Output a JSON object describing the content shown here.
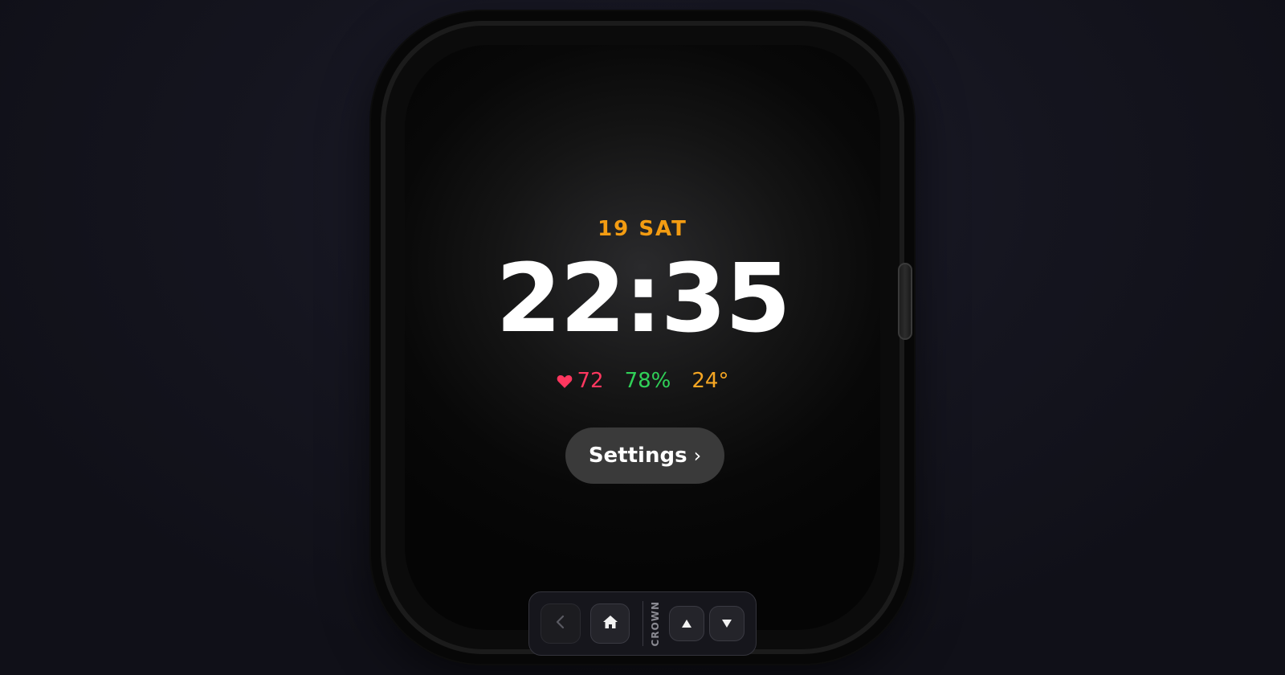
{
  "watch": {
    "date": "19 SAT",
    "time": "22:35",
    "complications": {
      "heart_rate": "72",
      "battery": "78%",
      "temperature": "24°"
    },
    "settings_button": {
      "label": "Settings",
      "chevron": "›"
    }
  },
  "controls": {
    "crown_label": "CROWN",
    "back_icon": "chevron-left-icon",
    "home_icon": "home-icon",
    "up_icon": "triangle-up-icon",
    "down_icon": "triangle-down-icon"
  },
  "colors": {
    "date": "#f39c12",
    "heart": "#ff375f",
    "battery": "#30d158",
    "temperature": "#f5a623"
  }
}
